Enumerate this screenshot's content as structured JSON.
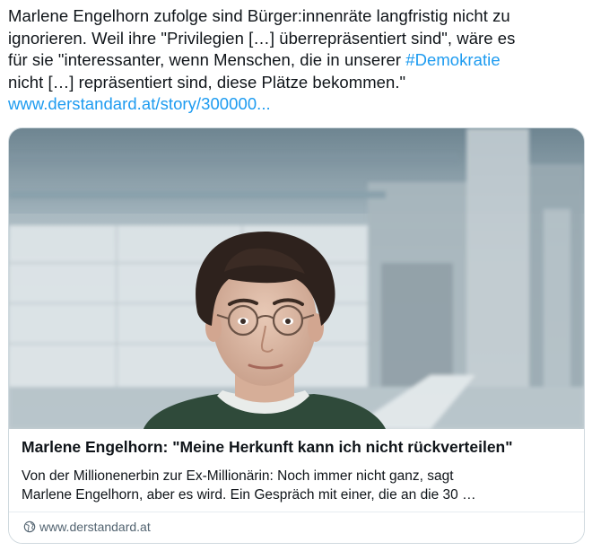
{
  "post": {
    "line1": "Marlene Engelhorn zufolge sind Bürger:innenräte langfristig nicht zu",
    "line2": "ignorieren. Weil ihre \"Privilegien […] überrepräsentiert sind\", wäre es",
    "line3_pre": "für sie \"interessanter, wenn Menschen, die in unserer ",
    "hashtag": "#Demokratie",
    "line4": "nicht […] repräsentiert sind, diese Plätze bekommen.\"",
    "link": "www.derstandard.at/story/300000..."
  },
  "card": {
    "title": "Marlene Engelhorn: \"Meine Herkunft kann ich nicht rückverteilen\"",
    "desc_line1": "Von der Millionenerbin zur Ex-Millionärin: Noch immer nicht ganz, sagt",
    "desc_line2": "Marlene Engelhorn, aber es wird. Ein Gespräch mit einer, die an die 30 …",
    "domain": "www.derstandard.at",
    "domain_icon": "globe-icon"
  },
  "colors": {
    "link": "#1d9bf0",
    "text": "#0f1419",
    "muted": "#536471",
    "border": "#cfd9de"
  }
}
